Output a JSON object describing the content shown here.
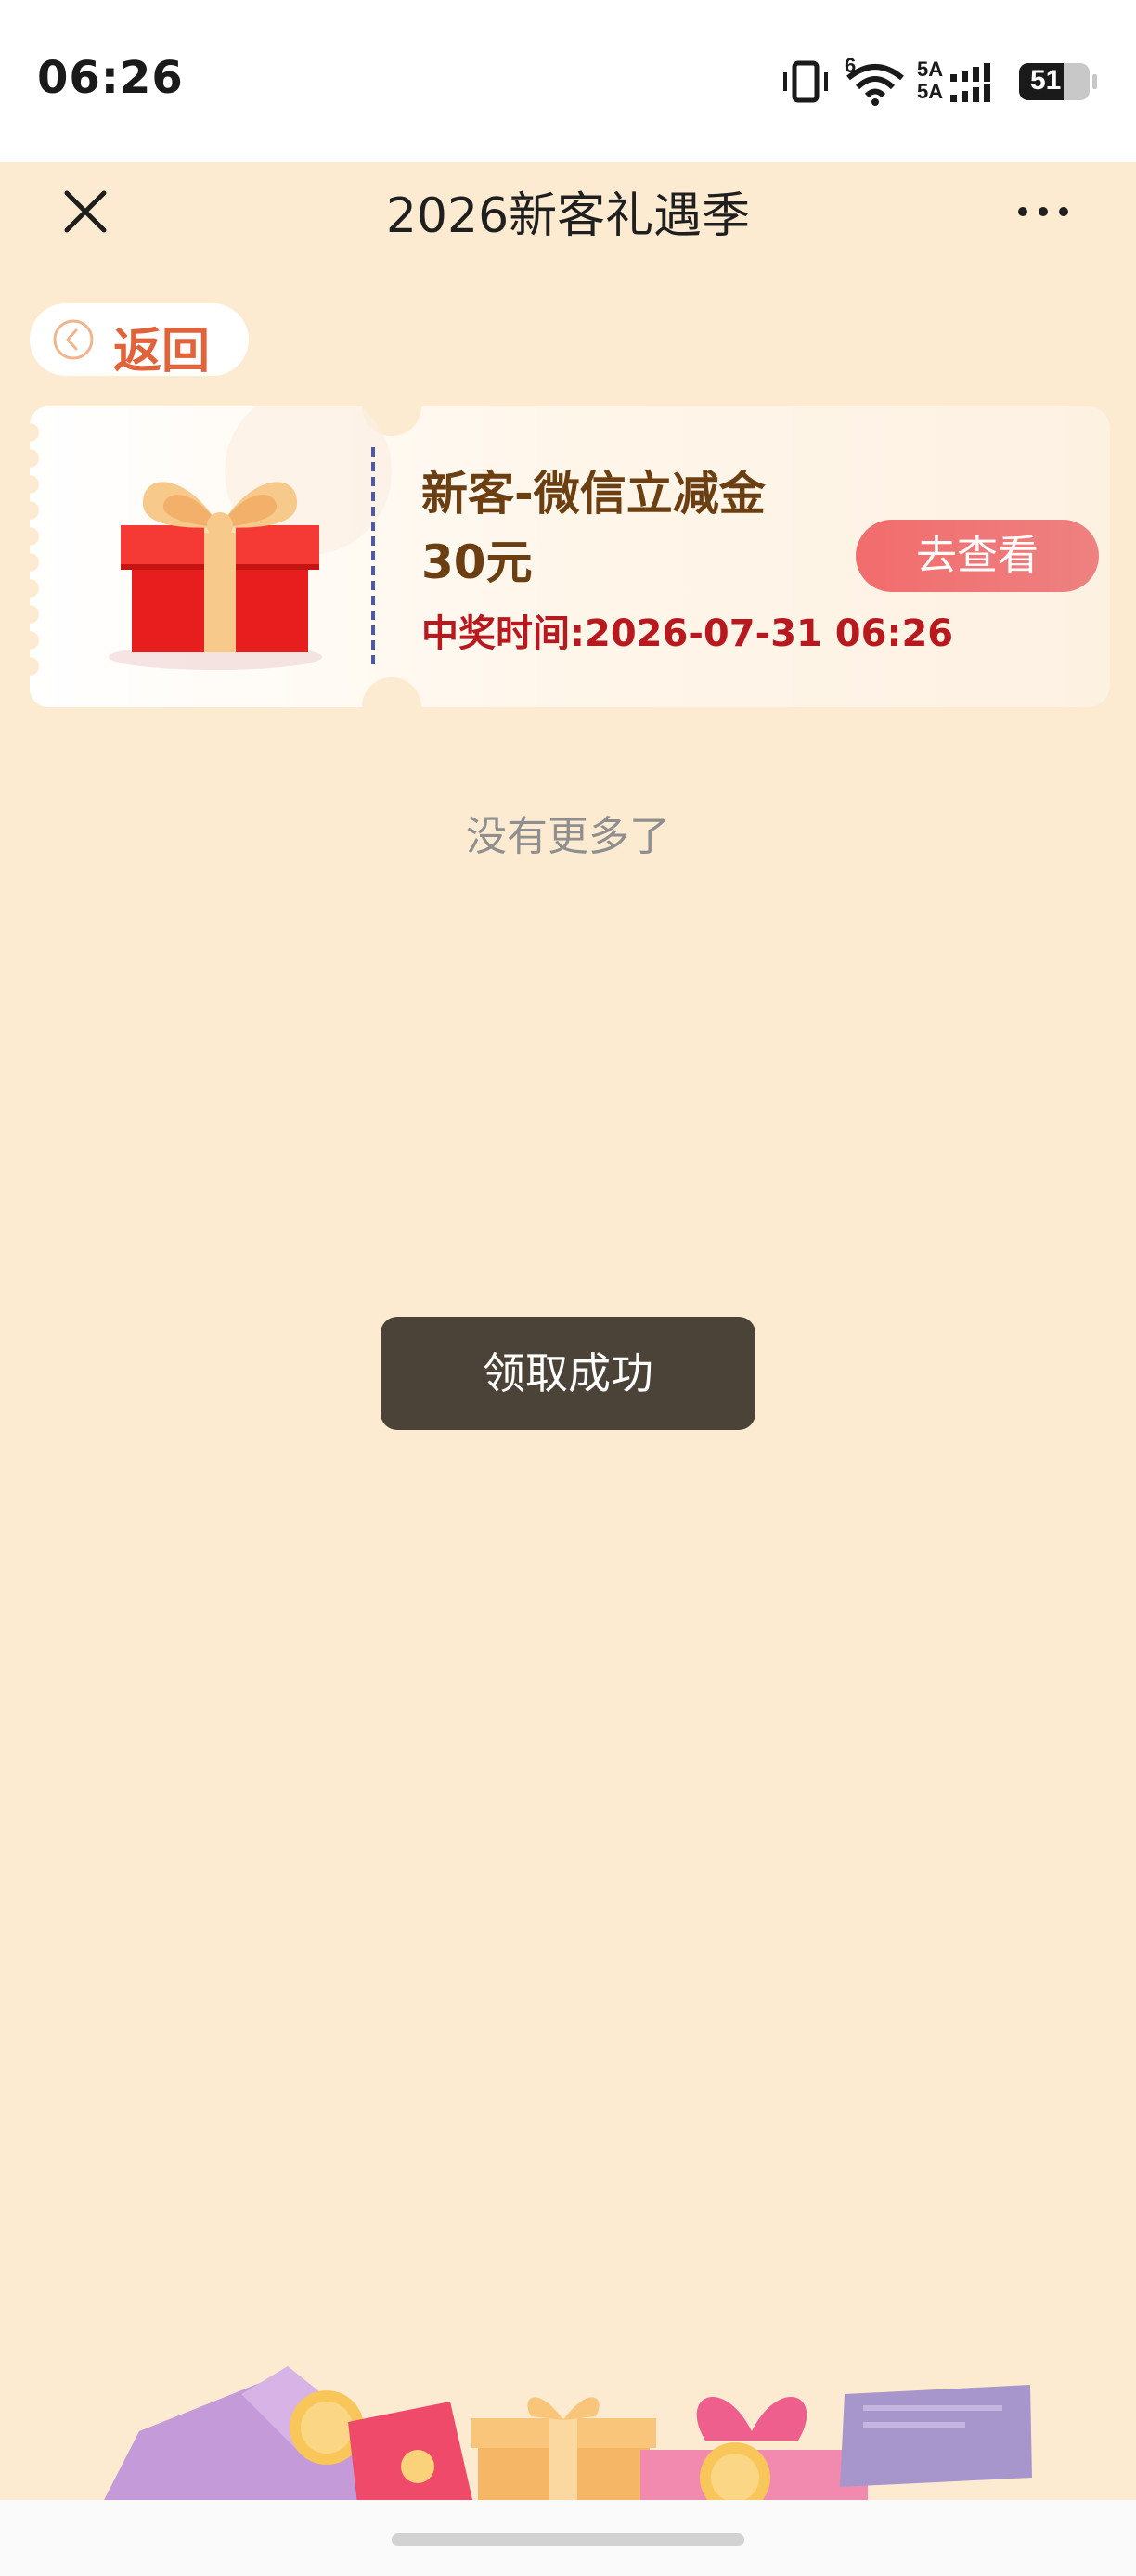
{
  "status_bar": {
    "time": "06:26",
    "network_label": "5A",
    "network_label_2": "5A",
    "wifi_badge": "6",
    "battery": "51",
    "icons": [
      "vibrate-icon",
      "wifi-icon",
      "signal-icon",
      "battery-icon"
    ]
  },
  "nav": {
    "title": "2026新客礼遇季",
    "close_icon": "close-icon",
    "more_icon": "more-icon"
  },
  "back_button": {
    "label": "返回",
    "icon": "chevron-left-circle-icon"
  },
  "prize_card": {
    "name": "新客-微信立减金",
    "amount": "30元",
    "time_label": "中奖时间:",
    "time_value": "2026-07-31 06:26",
    "action_label": "去查看",
    "image": "gift-box-icon"
  },
  "list_footer": "没有更多了",
  "toast": "领取成功",
  "colors": {
    "background": "#fcebd0",
    "title_text": "#6b3f12",
    "time_text": "#b8191f",
    "button": "#f26c6c",
    "back_label": "#e2623a"
  }
}
